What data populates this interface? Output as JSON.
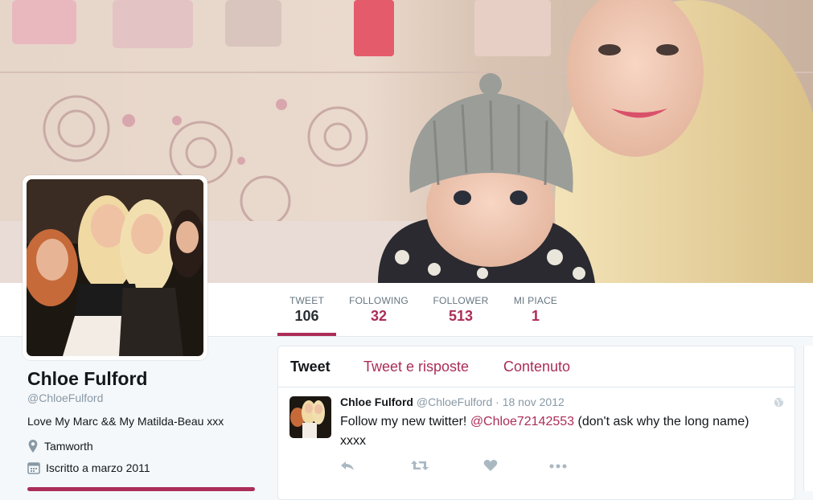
{
  "theme": {
    "accent": "#ab2d58",
    "background": "#f5f8fa"
  },
  "profile": {
    "name": "Chloe Fulford",
    "handle": "@ChloeFulford",
    "bio": "Love My Marc && My Matilda-Beau xxx",
    "location": "Tamworth",
    "location_icon": "map-pin-icon",
    "joined": "Iscritto a marzo 2011",
    "joined_icon": "calendar-icon"
  },
  "stats": [
    {
      "label": "TWEET",
      "value": "106",
      "active": true
    },
    {
      "label": "FOLLOWING",
      "value": "32",
      "active": false
    },
    {
      "label": "FOLLOWER",
      "value": "513",
      "active": false
    },
    {
      "label": "MI PIACE",
      "value": "1",
      "active": false
    }
  ],
  "timeline": {
    "tabs": [
      {
        "label": "Tweet",
        "active": true
      },
      {
        "label": "Tweet e risposte",
        "active": false
      },
      {
        "label": "Contenuto",
        "active": false
      }
    ],
    "tweet": {
      "name": "Chloe Fulford",
      "handle": "@ChloeFulford",
      "separator": "·",
      "date": "18 nov 2012",
      "text_before": "Follow my new twitter! ",
      "mention": "@Chloe72142553",
      "text_after": " (don't ask why the long name) xxxx",
      "actions": [
        "reply-icon",
        "retweet-icon",
        "like-icon",
        "more-icon"
      ]
    }
  }
}
